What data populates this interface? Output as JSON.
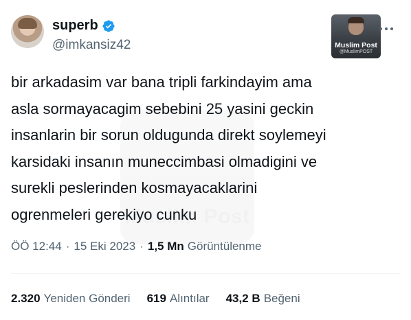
{
  "author": {
    "display_name": "superb",
    "handle": "@imkansiz42"
  },
  "badge": {
    "title": "Muslim Post",
    "subtitle": "@MuslimPOST"
  },
  "watermark": {
    "title": "Muslim Post"
  },
  "tweet": {
    "lines": [
      "bir arkadasim var bana tripli farkindayim ama",
      "asla sormayacagim sebebini 25 yasini geckin",
      "insanlarin bir sorun oldugunda direkt soylemeyi",
      "karsidaki insanın muneccimbasi olmadigini ve",
      "surekli peslerinden kosmayacaklarini",
      "ogrenmeleri gerekiyo cunku"
    ]
  },
  "meta": {
    "time": "ÖÖ 12:44",
    "separator": "·",
    "date": "15 Eki 2023",
    "views_count": "1,5 Mn",
    "views_label": "Görüntülenme"
  },
  "stats": {
    "reposts_count": "2.320",
    "reposts_label": "Yeniden Gönderi",
    "quotes_count": "619",
    "quotes_label": "Alıntılar",
    "likes_count": "43,2 B",
    "likes_label": "Beğeni"
  },
  "icons": {
    "verified": "verified-badge-icon",
    "more": "more-options-icon"
  },
  "colors": {
    "verified_blue": "#1d9bf0",
    "text_primary": "#0f1419",
    "text_secondary": "#536471"
  }
}
